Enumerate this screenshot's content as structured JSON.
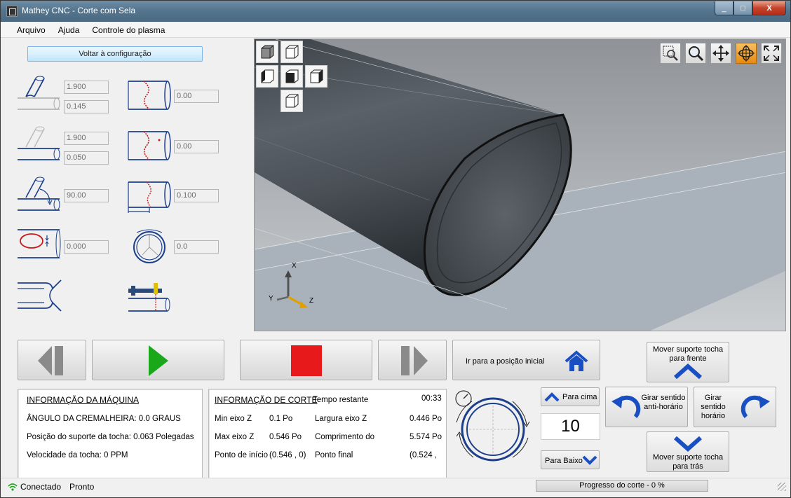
{
  "window": {
    "title": "Mathey CNC - Corte com Sela",
    "min": "_",
    "max": "□",
    "close": "X"
  },
  "menu": [
    "Arquivo",
    "Ajuda",
    "Controle do plasma"
  ],
  "config_button": "Voltar à configuração",
  "params": {
    "p1a": "1.900",
    "p1b": "0.145",
    "p2": "0.00",
    "p3a": "1.900",
    "p3b": "0.050",
    "p4": "0.00",
    "p5": "90.00",
    "p6": "0.100",
    "p7": "0.000",
    "p8": "0.0"
  },
  "viewport": {
    "axis_x": "X",
    "axis_y": "Y",
    "axis_z": "Z"
  },
  "buttons": {
    "home": "Ir para a posição inicial",
    "forward": "Mover suporte tocha para frente",
    "back": "Mover suporte tocha para trás",
    "ccw": "Girar sentido anti-horário",
    "cw": "Girar sentido horário",
    "up": "Para cima",
    "down": "Para Baixo"
  },
  "step_value": "10",
  "machine_info": {
    "title": "INFORMAÇÃO DA MÁQUINA",
    "rack": "ÂNGULO DA CREMALHEIRA: 0.0 GRAUS",
    "torch_pos": "Posição do suporte da tocha: 0.063 Polegadas",
    "torch_speed": "Velocidade da tocha: 0 PPM"
  },
  "cut_info": {
    "title": "INFORMAÇÃO DE CORTE",
    "remaining_label": "Tempo restante",
    "remaining": "00:33",
    "min_z_label": "Min eixo Z",
    "min_z": "0.1 Po",
    "width_z_label": "Largura eixo Z",
    "width_z": "0.446 Po",
    "max_z_label": "Max eixo Z",
    "max_z": "0.546 Po",
    "length_label": "Comprimento do",
    "length": "5.574 Po",
    "start_label": "Ponto de início",
    "start": "(0.546 , 0)",
    "end_label": "Ponto final",
    "end": "(0.524 ,"
  },
  "status": {
    "connected": "Conectado",
    "ready": "Pronto",
    "progress": "Progresso do corte - 0 %",
    "progress_value": 0
  },
  "colors": {
    "play": "#1aa81a",
    "stop": "#e8191a",
    "accent_blue": "#1a4fc4",
    "active_tool": "#e78a10"
  }
}
